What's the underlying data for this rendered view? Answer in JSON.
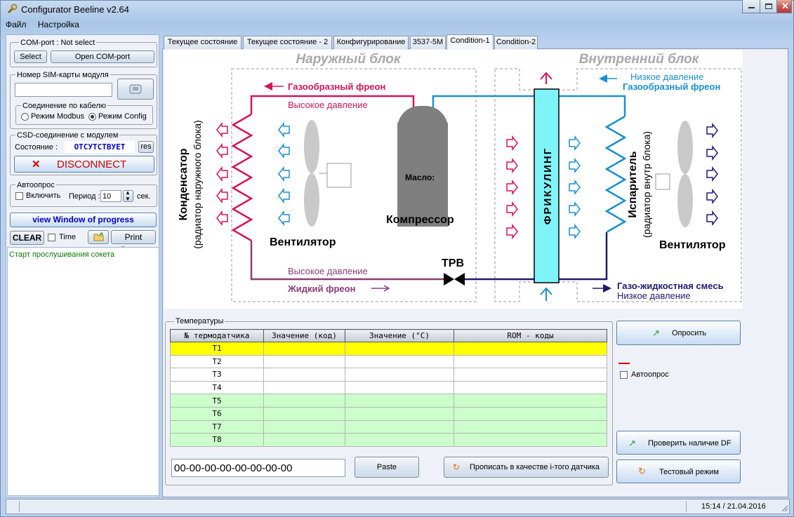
{
  "window": {
    "title": "Configurator Beeline v2.64"
  },
  "menu": [
    "Файл",
    "Настройка"
  ],
  "left": {
    "com": {
      "label": "COM-port : Not select",
      "select_btn": "Select",
      "open_btn": "Open  COM-port"
    },
    "sim": {
      "label": "Номер SIM-карты модуля",
      "value": ""
    },
    "cable": {
      "label": "Соединение по кабелю",
      "modbus": "Режим Modbus",
      "config": "Режим Config",
      "selected": "config"
    },
    "csd": {
      "label": "CSD-соединение с модулем",
      "state_label": "Состояние :",
      "state_value": "ОТСУТСТВУЕТ",
      "res_btn": "res",
      "disconnect_btn": "DISCONNECT"
    },
    "auto": {
      "label": "Автоопрос",
      "enable": "Включить",
      "period_label": "Период :",
      "period_value": "10",
      "unit": "сек."
    },
    "progress_btn": "view Window of progress",
    "clear_btn": "CLEAR",
    "time_label": "Time",
    "print_btn": "Print Screen",
    "log": "Старт прослушивания сокета"
  },
  "tabs": [
    {
      "label": "Текущее состояние",
      "active": false
    },
    {
      "label": "Текущее состояние - 2",
      "active": false
    },
    {
      "label": "Конфигурирование",
      "active": false
    },
    {
      "label": "3537-5M",
      "active": false
    },
    {
      "label": "Condition-1",
      "active": true
    },
    {
      "label": "Condition-2",
      "active": false
    }
  ],
  "diagram": {
    "outer_title": "Наружный блок",
    "inner_title": "Внутренний блок",
    "gas_freon": "Газообразный фреон",
    "high_pressure_top": "Высокое давление",
    "low_pressure_top": "Низкое давление",
    "gas_freon_in": "Газообразный фреон",
    "condenser": "Конденсатор",
    "condenser_sub": "(радиатор наружного блока)",
    "fan_out": "Вентилятор",
    "oil": "Масло:",
    "compressor": "Компрессор",
    "freecooling": "ФРИКУЛИНГ",
    "evaporator": "Испаритель",
    "evaporator_sub": "(радиатор внутр блока)",
    "fan_in": "Вентилятор",
    "trv": "ТРВ",
    "high_pressure_bottom": "Высокое давление",
    "liquid_freon": "Жидкий фреон",
    "gas_liquid": "Газо-жидкостная смесь",
    "low_pressure_bottom": "Низкое давление"
  },
  "temps": {
    "label": "Температуры",
    "headers": [
      "№ термодатчика",
      "Значение (код)",
      "Значение (°C)",
      "ROM - коды"
    ],
    "rows": [
      {
        "name": "T1",
        "style": "yel"
      },
      {
        "name": "T2",
        "style": "wht"
      },
      {
        "name": "T3",
        "style": "wht"
      },
      {
        "name": "T4",
        "style": "wht"
      },
      {
        "name": "T5",
        "style": "grn"
      },
      {
        "name": "T6",
        "style": "grn"
      },
      {
        "name": "T7",
        "style": "grn"
      },
      {
        "name": "T8",
        "style": "grn"
      }
    ],
    "rom_value": "00-00-00-00-00-00-00-00",
    "paste_btn": "Paste",
    "write_btn": "Прописать в качестве i-того датчика"
  },
  "right": {
    "poll_btn": "Опросить",
    "auto_label": "Автоопрос",
    "check_df_btn": "Проверить наличие DF",
    "test_btn": "Тестовый режим"
  },
  "status": {
    "datetime": "15:14 / 21.04.2016"
  },
  "colors": {
    "hot": "#d4145a",
    "cold": "#1a8fd0",
    "navy": "#1f1a6e",
    "freecool": "#7ff4f8"
  }
}
